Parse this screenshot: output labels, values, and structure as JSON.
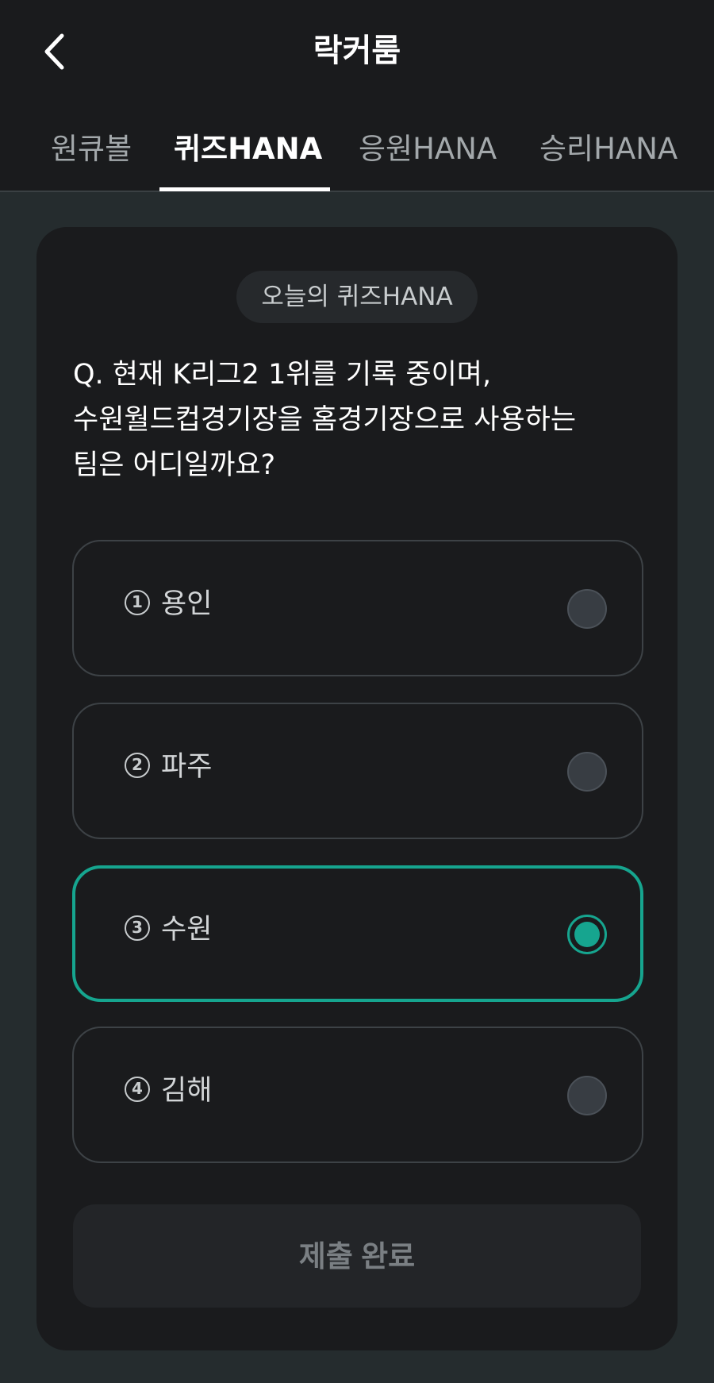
{
  "header": {
    "title": "락커룸",
    "back_icon": "chevron-left-icon"
  },
  "tabs": [
    {
      "label": "원큐볼",
      "active": false
    },
    {
      "label": "퀴즈HANA",
      "active": true
    },
    {
      "label": "응원HANA",
      "active": false
    },
    {
      "label": "승리HANA",
      "active": false
    }
  ],
  "quiz": {
    "badge": "오늘의 퀴즈HANA",
    "question_lines": [
      "Q. 현재 K리그2 1위를 기록 중이며,",
      "수원월드컵경기장을 홈경기장으로 사용하는",
      "팀은 어디일까요?"
    ],
    "options": [
      {
        "number": "1",
        "label": "용인",
        "selected": false
      },
      {
        "number": "2",
        "label": "파주",
        "selected": false
      },
      {
        "number": "3",
        "label": "수원",
        "selected": true
      },
      {
        "number": "4",
        "label": "김해",
        "selected": false
      }
    ],
    "submit_label": "제출 완료"
  },
  "colors": {
    "background": "#252c2e",
    "surface": "#1a1b1d",
    "accent": "#16a58f",
    "muted_text": "#a3a8ab",
    "disabled_button": "#232528"
  }
}
